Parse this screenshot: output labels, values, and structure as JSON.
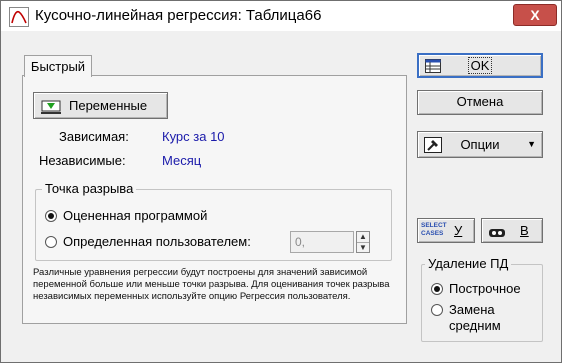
{
  "window": {
    "title": "Кусочно-линейная регрессия: Таблица66",
    "close_label": "X"
  },
  "tabs": [
    {
      "label": "Быстрый"
    }
  ],
  "variables_button": {
    "label": "Переменные"
  },
  "fields": {
    "dependent_label": "Зависимая:",
    "dependent_value": "Курс за 10",
    "independent_label": "Независимые:",
    "independent_value": "Месяц"
  },
  "breakpoint": {
    "title": "Точка разрыва",
    "options": [
      {
        "label": "Оцененная программой",
        "selected": true
      },
      {
        "label": "Определенная пользователем:",
        "selected": false
      }
    ],
    "value": "0,"
  },
  "note": "Различные уравнения регрессии будут построены для значений зависимой переменной больше или меньше точки разрыва. Для оценивания точек разрыва независимых переменных используйте опцию Регрессия пользователя.",
  "right_panel": {
    "ok_label": "OK",
    "cancel_label": "Отмена",
    "options_label": "Опции",
    "select_cases_icon_text": [
      "SELECT",
      "CASES"
    ],
    "select_cases_key": "У",
    "weights_key": "В",
    "missing": {
      "title": "Удаление ПД",
      "options": [
        {
          "label": "Построчное",
          "selected": true
        },
        {
          "label": "Замена средним",
          "selected": false
        }
      ]
    }
  },
  "icons": [
    "regression-app-icon",
    "variables-icon",
    "ok-grid-icon",
    "options-hammer-icon",
    "select-cases-icon",
    "weights-icon"
  ]
}
